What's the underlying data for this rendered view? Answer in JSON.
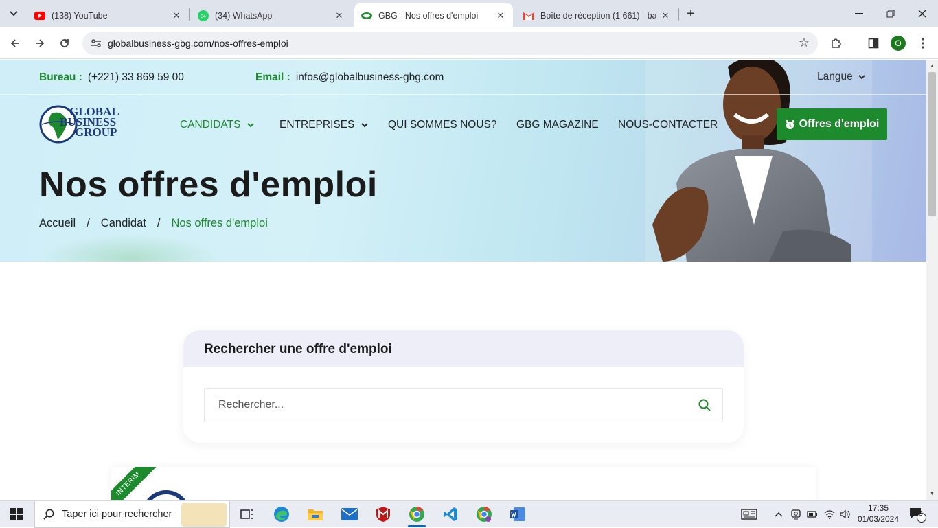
{
  "browser": {
    "tabs": [
      {
        "title": "(138) YouTube",
        "icon": "youtube-icon",
        "active": false
      },
      {
        "title": "(34) WhatsApp",
        "icon": "whatsapp-icon",
        "active": false,
        "badge": "34"
      },
      {
        "title": "GBG - Nos offres d'emploi",
        "icon": "gbg-icon",
        "active": true
      },
      {
        "title": "Boîte de réception (1 661) - bag",
        "icon": "gmail-icon",
        "active": false
      }
    ],
    "url": "globalbusiness-gbg.com/nos-offres-emploi",
    "profile_initial": "O"
  },
  "topbar": {
    "bureau_label": "Bureau :",
    "bureau_value": "(+221) 33 869 59 00",
    "email_label": "Email :",
    "email_value": "infos@globalbusiness-gbg.com",
    "langue": "Langue"
  },
  "logo": {
    "line1": "GLOBAL",
    "line2": "BUSINESS",
    "line3": "GROUP"
  },
  "nav": {
    "candidats": "CANDIDATS",
    "entreprises": "ENTREPRISES",
    "qui": "QUI SOMMES NOUS?",
    "magazine": "GBG MAGAZINE",
    "contact": "NOUS-CONTACTER",
    "cta": "Offres d'emploi"
  },
  "hero": {
    "title": "Nos offres d'emploi",
    "breadcrumb": [
      "Accueil",
      "Candidat",
      "Nos offres d'emploi"
    ]
  },
  "search": {
    "heading": "Rechercher une offre d'emploi",
    "placeholder": "Rechercher..."
  },
  "job": {
    "ribbon": "INTERIM"
  },
  "taskbar": {
    "search_placeholder": "Taper ici pour rechercher",
    "time": "17:35",
    "date": "01/03/2024",
    "notifications": "3"
  },
  "colors": {
    "brand_green": "#1e8a2e",
    "brand_blue": "#1a3a7a"
  }
}
